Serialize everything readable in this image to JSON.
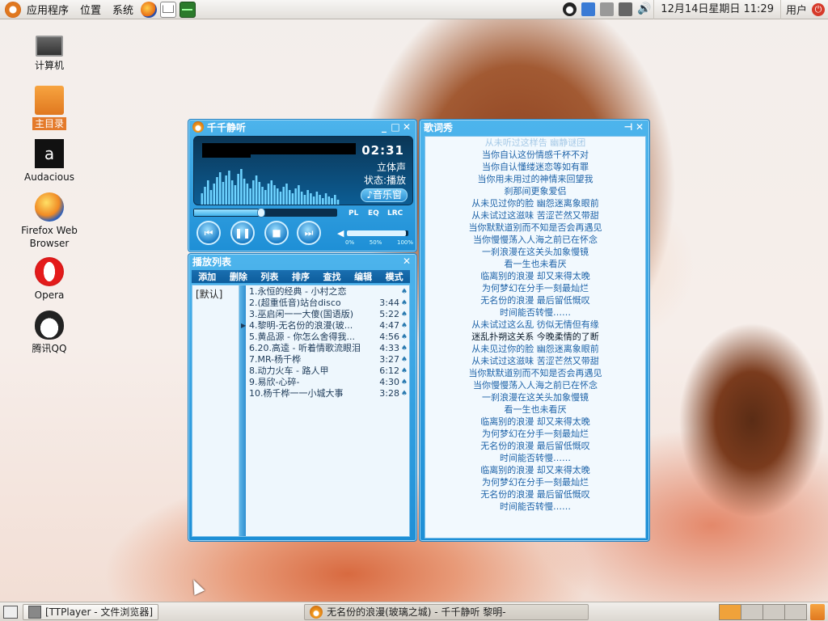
{
  "top_panel": {
    "menus": [
      "应用程序",
      "位置",
      "系统"
    ],
    "clock": "12月14日星期日 11:29",
    "user": "用户"
  },
  "desktop_icons": [
    {
      "label": "计算机",
      "icon": "computer-icon"
    },
    {
      "label": "主目录",
      "icon": "home-folder-icon",
      "selected": true
    },
    {
      "label": "Audacious",
      "icon": "audacious-icon"
    },
    {
      "label": "Firefox Web\nBrowser",
      "icon": "firefox-icon"
    },
    {
      "label": "Opera",
      "icon": "opera-icon"
    },
    {
      "label": "腾讯QQ",
      "icon": "qq-icon"
    }
  ],
  "player": {
    "title": "千千静听",
    "now_playing": "",
    "artist_line": "",
    "time": "02:31",
    "mode": "立体声",
    "status_label": "状态:",
    "status_value": "播放",
    "music_window_btn": "♪音乐窗",
    "tab_pl": "PL",
    "tab_eq": "EQ",
    "tab_lrc": "LRC",
    "seek_progress": 0.47,
    "volume_level": 0.96,
    "volume_marks": [
      "0%",
      "50%",
      "100%"
    ],
    "spectrum": [
      14,
      22,
      30,
      18,
      26,
      34,
      40,
      28,
      36,
      42,
      30,
      24,
      38,
      44,
      32,
      26,
      20,
      30,
      36,
      28,
      22,
      18,
      26,
      30,
      24,
      20,
      16,
      22,
      26,
      18,
      14,
      20,
      24,
      16,
      12,
      18,
      14,
      10,
      16,
      12,
      8,
      14,
      10,
      8,
      12,
      6
    ]
  },
  "playlist": {
    "title": "播放列表",
    "menu": [
      "添加",
      "删除",
      "列表",
      "排序",
      "查找",
      "编辑",
      "模式"
    ],
    "group": "[默认]",
    "current_index": 3,
    "tracks": [
      {
        "title": "1.永恒的经典 - 小村之恋",
        "duration": ""
      },
      {
        "title": "2.(超重低音)站台disco",
        "duration": "3:44"
      },
      {
        "title": "3.巫启闲一一大傻(国语版)",
        "duration": "5:22"
      },
      {
        "title": "4.黎明-无名份的浪漫(玻...",
        "duration": "4:47"
      },
      {
        "title": "5.黄品源 - 你怎么舍得我...",
        "duration": "4:56"
      },
      {
        "title": "6.20.高逵 - 听着情歌流眼泪",
        "duration": "4:33"
      },
      {
        "title": "7.MR-杨千桦",
        "duration": "3:27"
      },
      {
        "title": "8.动力火车 - 路人甲",
        "duration": "6:12"
      },
      {
        "title": "9.易欣-心碎-",
        "duration": "4:30"
      },
      {
        "title": "10.杨千桦一一小城大事",
        "duration": "3:28"
      }
    ]
  },
  "lyrics": {
    "title": "歌词秀",
    "lines": [
      {
        "text": "从未听过这样告 幽静谜团",
        "style": "faded"
      },
      {
        "text": "当你自认这份情感千杯不对",
        "style": ""
      },
      {
        "text": "当你自认懂缕迷恋等如有罪",
        "style": ""
      },
      {
        "text": "当你用未用过的神情来回望我",
        "style": ""
      },
      {
        "text": "刹那间更象爱侣",
        "style": ""
      },
      {
        "text": "从未见过你的脸 幽怨迷离象眼前",
        "style": ""
      },
      {
        "text": "从未试过这滋味 苦涩芒然又带甜",
        "style": ""
      },
      {
        "text": "当你默默道别而不知是否会再遇见",
        "style": ""
      },
      {
        "text": "当你慢慢荡入人海之前已在怀念",
        "style": ""
      },
      {
        "text": "一刹浪漫在这关头加象慢镜",
        "style": ""
      },
      {
        "text": "看一生也未看厌",
        "style": ""
      },
      {
        "text": "临离别的浪漫 却又来得太晚",
        "style": ""
      },
      {
        "text": "为何梦幻在分手一刻最灿烂",
        "style": ""
      },
      {
        "text": "无名份的浪漫 最后留低慨叹",
        "style": ""
      },
      {
        "text": "时间能否转慢……",
        "style": ""
      },
      {
        "text": "从未试过这么乱 彷似无情但有缘",
        "style": ""
      },
      {
        "text": "迷乱扑朔这关系 今晚柔情的了断",
        "style": "active"
      },
      {
        "text": "从未见过你的脸 幽怨迷离象眼前",
        "style": ""
      },
      {
        "text": "从未试过这滋味 苦涩芒然又带甜",
        "style": ""
      },
      {
        "text": "当你默默道别而不知是否会再遇见",
        "style": ""
      },
      {
        "text": "当你慢慢荡入人海之前已在怀念",
        "style": ""
      },
      {
        "text": "一刹浪漫在这关头加象慢镜",
        "style": ""
      },
      {
        "text": "看一生也未看厌",
        "style": ""
      },
      {
        "text": "临离别的浪漫 却又来得太晚",
        "style": ""
      },
      {
        "text": "为何梦幻在分手一刻最灿烂",
        "style": ""
      },
      {
        "text": "无名份的浪漫 最后留低慨叹",
        "style": ""
      },
      {
        "text": "时间能否转慢……",
        "style": ""
      },
      {
        "text": "临离别的浪漫 却又来得太晚",
        "style": ""
      },
      {
        "text": "为何梦幻在分手一刻最灿烂",
        "style": ""
      },
      {
        "text": "无名份的浪漫 最后留低慨叹",
        "style": ""
      },
      {
        "text": "时间能否转慢……",
        "style": ""
      }
    ]
  },
  "bottom_panel": {
    "task_fm": "[TTPlayer - 文件浏览器]",
    "task_player": "无名份的浪漫(玻璃之城) - 千千静听    黎明-",
    "workspace_count": 4,
    "active_workspace": 0
  },
  "colors": {
    "player_blue": "#1e8fd6",
    "lyric_text": "#1e63a8",
    "selection_orange": "#e47a2a"
  }
}
